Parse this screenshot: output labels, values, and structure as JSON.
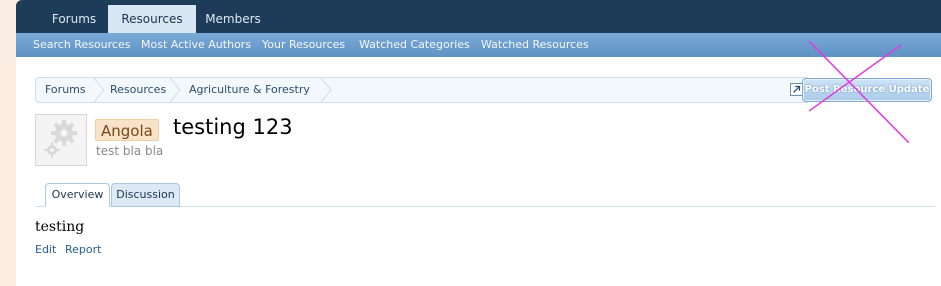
{
  "nav": {
    "tabs": [
      "Forums",
      "Resources",
      "Members"
    ],
    "active_tab": "Resources"
  },
  "subnav": {
    "links": [
      "Search Resources",
      "Most Active Authors",
      "Your Resources",
      "Watched Categories",
      "Watched Resources"
    ]
  },
  "breadcrumb": {
    "items": [
      "Forums",
      "Resources",
      "Agriculture & Forestry"
    ]
  },
  "actions": {
    "post_update_label": "Post Resource Update"
  },
  "resource": {
    "prefix": "Angola",
    "title": "testing 123",
    "tagline": "test bla bla",
    "icon": "gear-icon"
  },
  "content_tabs": {
    "items": [
      "Overview",
      "Discussion"
    ],
    "active": "Overview"
  },
  "description": {
    "text": "testing"
  },
  "post_actions": {
    "items": [
      "Edit",
      "Report"
    ]
  },
  "colors": {
    "topbar": "#1d3c59",
    "subbar": "#6d9ecd",
    "prefix_bg": "#f8e2c8",
    "overlay_x": "#e23be0"
  }
}
